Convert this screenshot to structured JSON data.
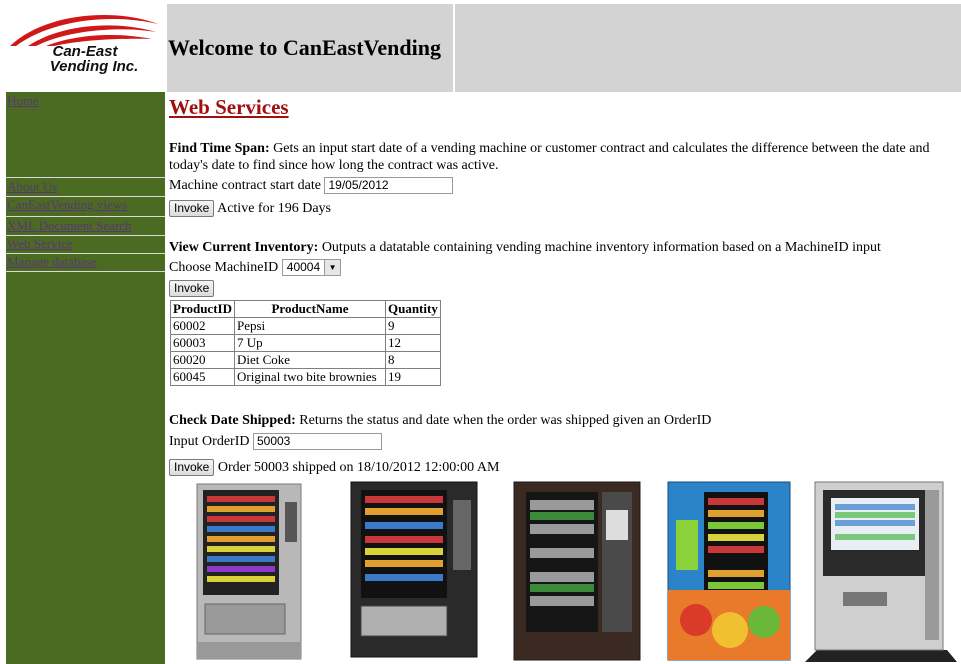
{
  "logo": {
    "line1": "Can-East",
    "line2": "Vending Inc."
  },
  "header": {
    "title": "Welcome to CanEastVending"
  },
  "sidebar": {
    "items": [
      {
        "label": "Home"
      },
      {
        "label": "About Us"
      },
      {
        "label": "CanEastVending views"
      },
      {
        "label": "XML Document Search"
      },
      {
        "label": "Web Service"
      },
      {
        "label": "Manage database"
      }
    ]
  },
  "main": {
    "title": "Web Services",
    "time_span": {
      "heading": "Find Time Span:",
      "desc_line1": " Gets an input start date of a vending machine or customer contract and calculates the difference between the date and",
      "desc_line2": "today's date to find since how long the contract was active.",
      "label": "Machine contract start date",
      "value": "19/05/2012",
      "button": "Invoke",
      "result": "Active for 196 Days"
    },
    "inventory": {
      "heading": "View Current Inventory:",
      "desc": " Outputs a datatable containing vending machine inventory information based on a MachineID input",
      "label": "Choose MachineID",
      "selected": "40004",
      "button": "Invoke",
      "columns": [
        "ProductID",
        "ProductName",
        "Quantity"
      ],
      "rows": [
        [
          "60002",
          "Pepsi",
          "9"
        ],
        [
          "60003",
          "7 Up",
          "12"
        ],
        [
          "60020",
          "Diet Coke",
          "8"
        ],
        [
          "60045",
          "Original two bite brownies",
          "19"
        ]
      ]
    },
    "shipped": {
      "heading": "Check Date Shipped:",
      "desc": " Returns the status and date when the order was shipped given an OrderID",
      "label": "Input OrderID",
      "value": "50003",
      "button": "Invoke",
      "result": "Order 50003 shipped on 18/10/2012 12:00:00 AM"
    }
  },
  "colors": {
    "sidebar": "#4b6b22",
    "header": "#d3d3d3",
    "title": "#a01010",
    "link": "#5a3575",
    "logo_red": "#d01818"
  }
}
